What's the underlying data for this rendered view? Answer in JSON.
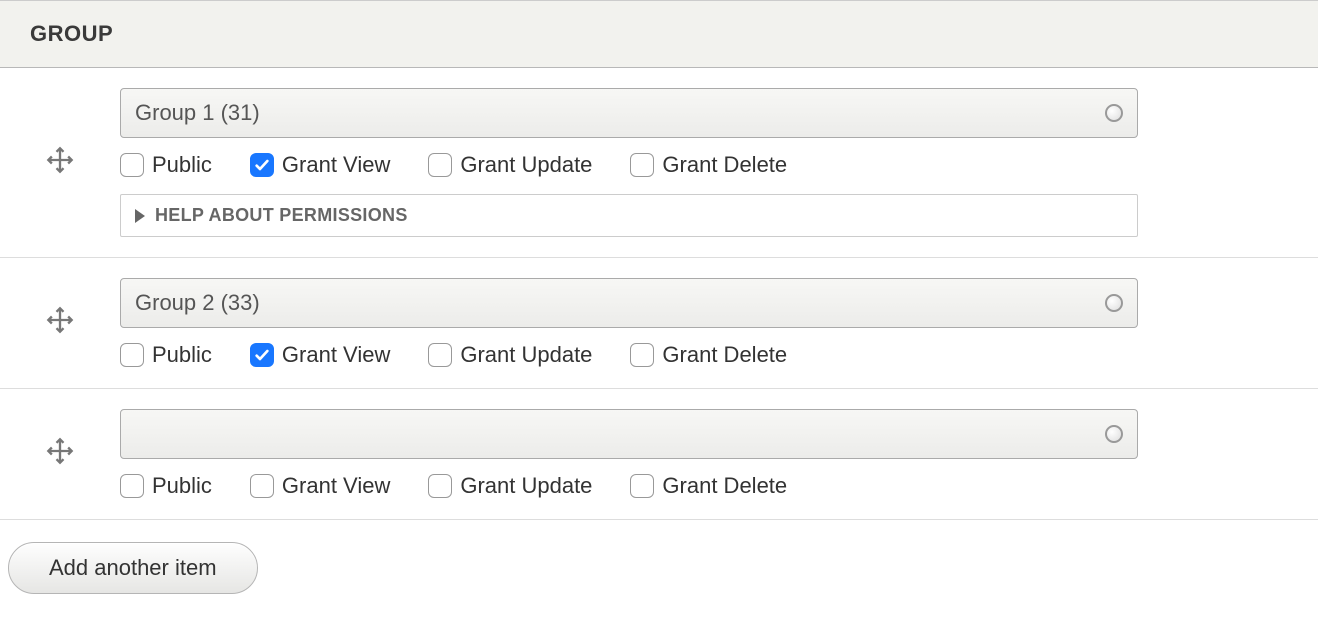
{
  "header": {
    "title": "GROUP"
  },
  "labels": {
    "public": "Public",
    "grant_view": "Grant View",
    "grant_update": "Grant Update",
    "grant_delete": "Grant Delete",
    "help": "HELP ABOUT PERMISSIONS",
    "add_button": "Add another item"
  },
  "rows": [
    {
      "selected": "Group 1 (31)",
      "public": false,
      "grant_view": true,
      "grant_update": false,
      "grant_delete": false,
      "show_help": true
    },
    {
      "selected": "Group 2 (33)",
      "public": false,
      "grant_view": true,
      "grant_update": false,
      "grant_delete": false,
      "show_help": false
    },
    {
      "selected": "",
      "public": false,
      "grant_view": false,
      "grant_update": false,
      "grant_delete": false,
      "show_help": false
    }
  ]
}
